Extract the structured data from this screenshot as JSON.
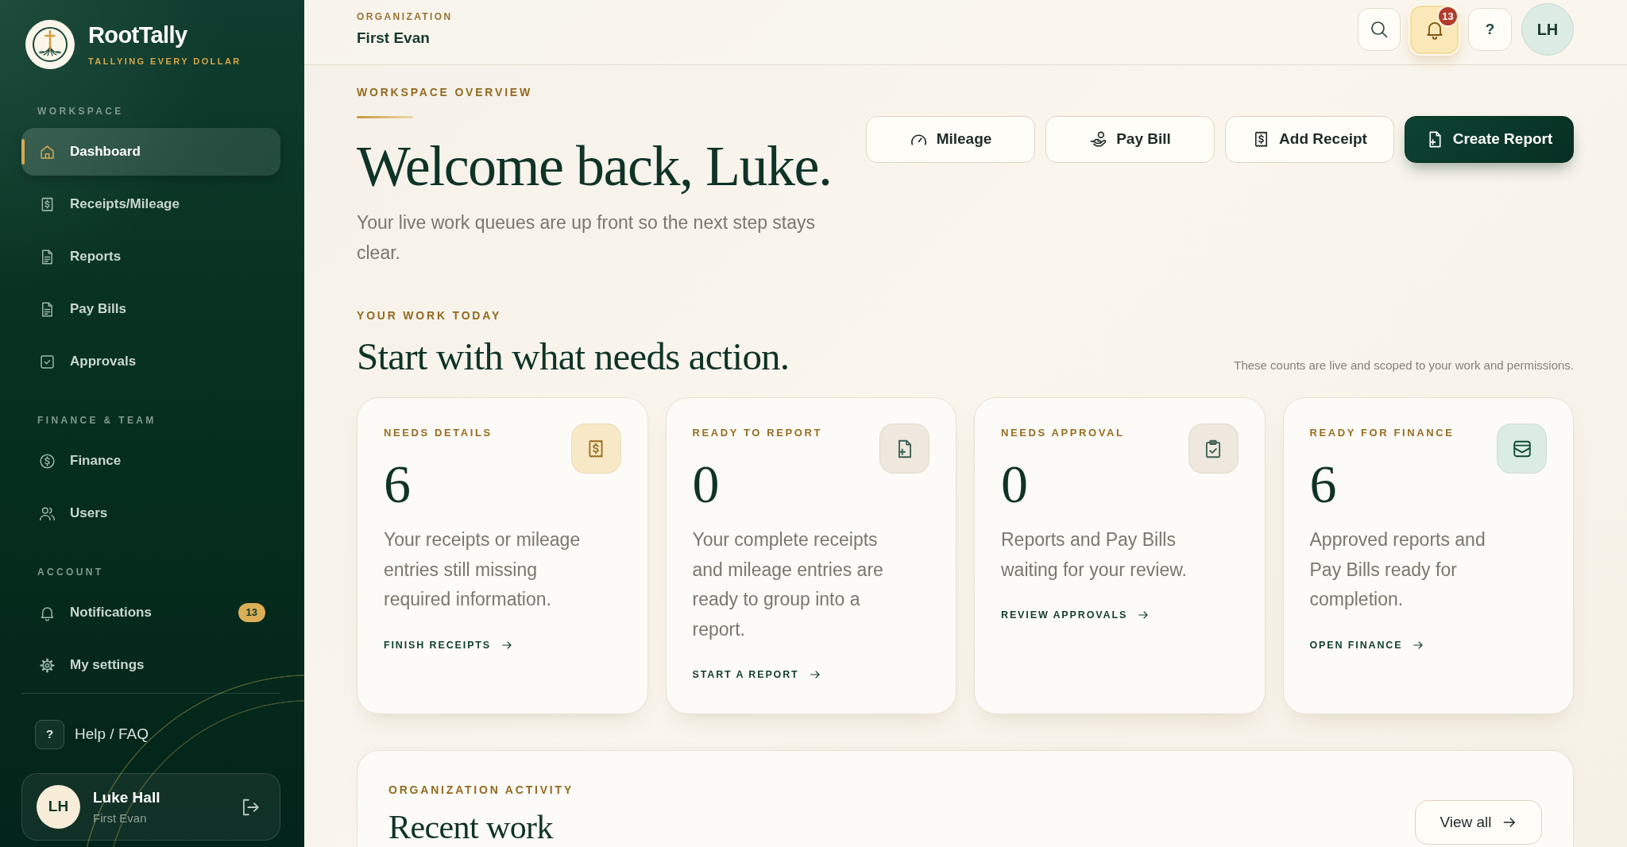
{
  "sidebar": {
    "brand": {
      "name": "RootTally",
      "tagline": "TALLYING EVERY DOLLAR"
    },
    "sections": [
      {
        "label": "WORKSPACE",
        "items": [
          {
            "label": "Dashboard",
            "selected": true
          },
          {
            "label": "Receipts/Mileage",
            "selected": false
          },
          {
            "label": "Reports",
            "selected": false
          },
          {
            "label": "Pay Bills",
            "selected": false
          },
          {
            "label": "Approvals",
            "selected": false
          }
        ]
      },
      {
        "label": "FINANCE & TEAM",
        "items": [
          {
            "label": "Finance",
            "selected": false
          },
          {
            "label": "Users",
            "selected": false
          }
        ]
      },
      {
        "label": "ACCOUNT",
        "items": [
          {
            "label": "Notifications",
            "selected": false,
            "badge": "13"
          },
          {
            "label": "My settings",
            "selected": false
          }
        ]
      }
    ],
    "help": {
      "icon": "?",
      "label": "Help / FAQ"
    },
    "user": {
      "initials": "LH",
      "name": "Luke Hall",
      "organization": "First Evan"
    }
  },
  "header": {
    "organization_label": "ORGANIZATION",
    "organization": "First Evan",
    "notification_count": "13",
    "help": "?",
    "avatar": "LH"
  },
  "overview": {
    "eyebrow": "WORKSPACE OVERVIEW",
    "title": "Welcome back, Luke.",
    "subtitle": "Your live work queues are up front so the next step stays clear.",
    "actions": [
      {
        "label": "Mileage",
        "kind": "outline"
      },
      {
        "label": "Pay Bill",
        "kind": "outline"
      },
      {
        "label": "Add Receipt",
        "kind": "outline"
      },
      {
        "label": "Create Report",
        "kind": "primary"
      }
    ]
  },
  "work_today": {
    "eyebrow": "YOUR WORK TODAY",
    "title": "Start with what needs action.",
    "note": "These counts are live and scoped to your work and permissions.",
    "cards": [
      {
        "label": "NEEDS DETAILS",
        "count": "6",
        "description": "Your receipts or mileage entries still missing required information.",
        "link": "FINISH RECEIPTS",
        "color": "#f8e9c6"
      },
      {
        "label": "READY TO REPORT",
        "count": "0",
        "description": "Your complete receipts and mileage entries are ready to group into a report.",
        "link": "START A REPORT",
        "color": "#efe8de"
      },
      {
        "label": "NEEDS APPROVAL",
        "count": "0",
        "description": "Reports and Pay Bills waiting for your review.",
        "link": "REVIEW APPROVALS",
        "color": "#efe8de"
      },
      {
        "label": "READY FOR FINANCE",
        "count": "6",
        "description": "Approved reports and Pay Bills ready for completion.",
        "link": "OPEN FINANCE",
        "color": "#dbede3"
      }
    ]
  },
  "activity": {
    "eyebrow": "ORGANIZATION ACTIVITY",
    "title": "Recent work",
    "button": "View all"
  }
}
